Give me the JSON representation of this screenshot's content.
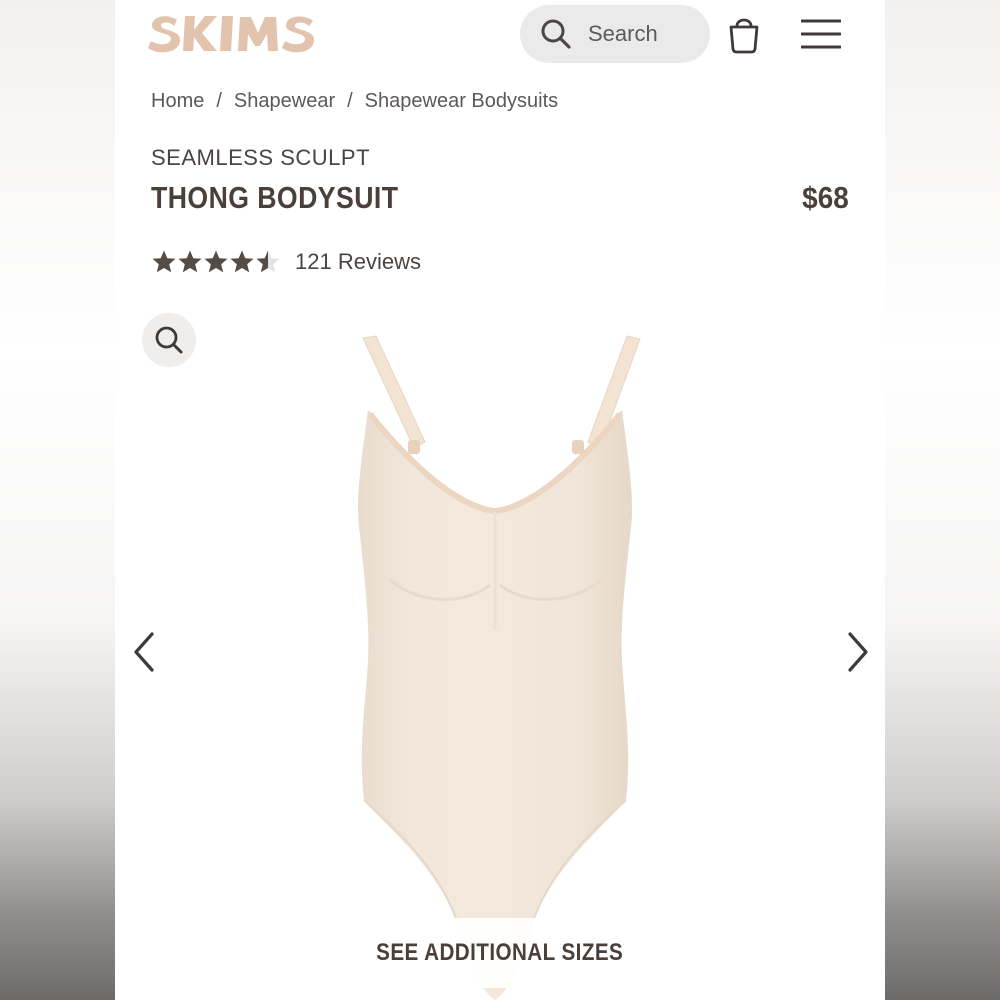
{
  "header": {
    "logo_text": "SKIMS",
    "search_label": "Search",
    "icons": [
      "search-icon",
      "shopping-bag-icon",
      "menu-icon"
    ]
  },
  "breadcrumb": {
    "items": [
      "Home",
      "Shapewear",
      "Shapewear Bodysuits"
    ],
    "separator": "/"
  },
  "product": {
    "collection": "SEAMLESS SCULPT",
    "name": "THONG BODYSUIT",
    "price": "$68",
    "rating": 4.5,
    "rating_max": 5,
    "reviews_label": "121 Reviews"
  },
  "gallery": {
    "icons": [
      "zoom-icon",
      "chevron-left-icon",
      "chevron-right-icon"
    ],
    "sizes_button_label": "SEE ADDITIONAL SIZES"
  },
  "colors": {
    "logo": "#e2c3ad",
    "text": "#4a4039",
    "product": "#efe4d7",
    "star": "#554c46",
    "search_bg": "#ebeaea"
  }
}
